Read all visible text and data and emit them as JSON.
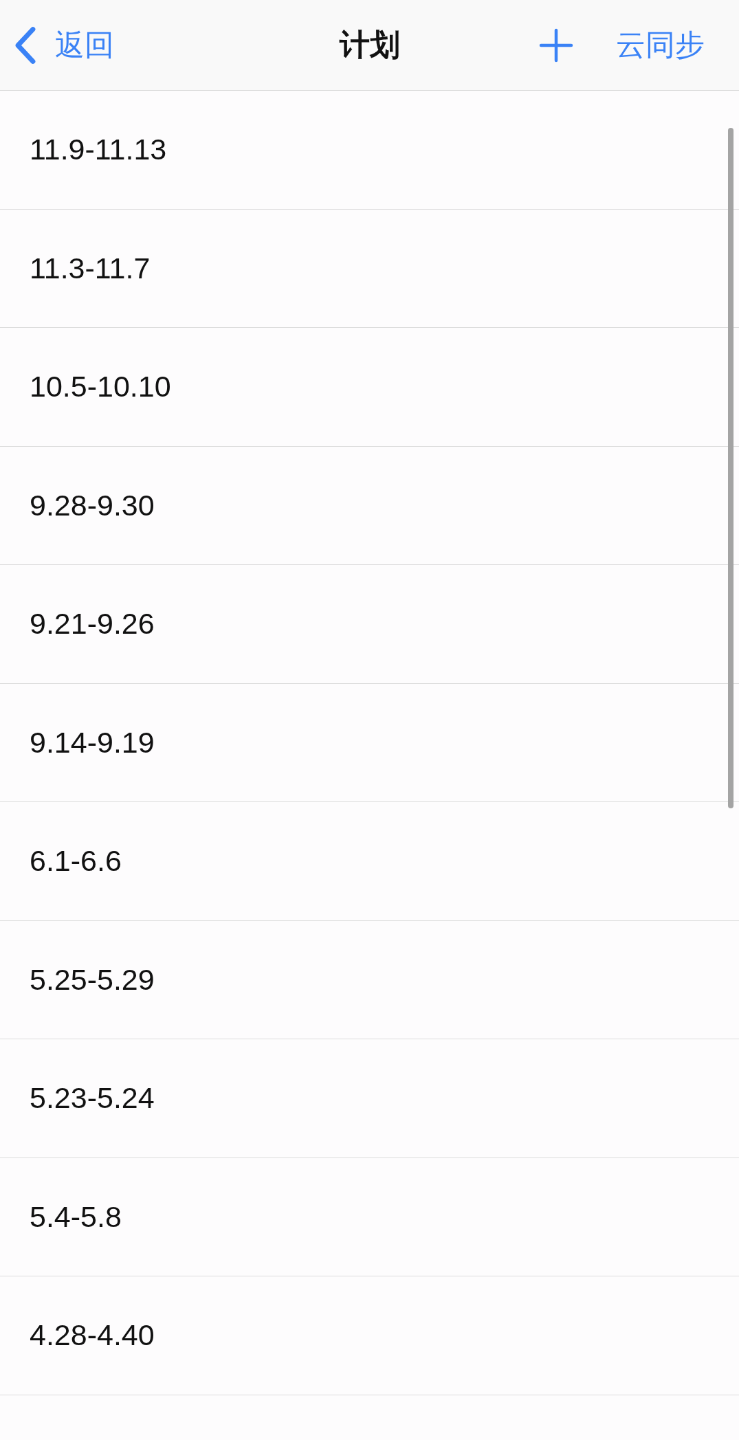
{
  "nav_bar": {
    "back_label": "返回",
    "title": "计划",
    "sync_label": "云同步"
  },
  "plans": [
    "11.9-11.13",
    "11.3-11.7",
    "10.5-10.10",
    "9.28-9.30",
    "9.21-9.26",
    "9.14-9.19",
    "6.1-6.6",
    "5.25-5.29",
    "5.23-5.24",
    "5.4-5.8",
    "4.28-4.40"
  ]
}
